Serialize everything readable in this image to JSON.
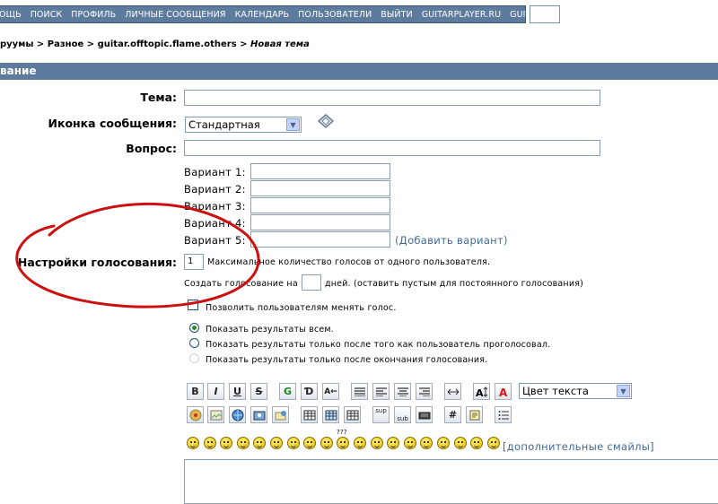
{
  "nav": {
    "items": [
      "ОЩЬ",
      "ПОИСК",
      "ПРОФИЛЬ",
      "ЛИЧНЫЕ СООБЩЕНИЯ",
      "КАЛЕНДАРЬ",
      "ПОЛЬЗОВАТЕЛИ",
      "ВЫЙТИ",
      "GUITARPLAYER.RU",
      "GUITARWIKI"
    ]
  },
  "breadcrumb": {
    "items": [
      "руумы",
      "Разное",
      "guitar.offtopic.flame.others"
    ],
    "separator": ">",
    "current": "Новая тема"
  },
  "section": {
    "title": "вание"
  },
  "form": {
    "subject_label": "Тема:",
    "icon_label": "Иконка сообщения:",
    "icon_value": "Стандартная",
    "question_label": "Вопрос:",
    "options": [
      {
        "label": "Вариант 1:"
      },
      {
        "label": "Вариант 2:"
      },
      {
        "label": "Вариант 3:"
      },
      {
        "label": "Вариант 4:"
      },
      {
        "label": "Вариант 5:"
      }
    ],
    "add_option": "(Добавить вариант)",
    "poll_settings_label": "Настройки голосования:",
    "max_votes_value": "1",
    "max_votes_text": "Максимальное количество голосов от одного пользователя.",
    "duration_before": "Создать голосование на",
    "duration_after": "дней. (оставить пустым для постоянного голосования)",
    "allow_change": "Позволить пользователям менять голос.",
    "result_options": [
      "Показать результаты всем.",
      "Показать результаты только после того как пользователь проголосовал.",
      "Показать результаты только после окончания голосования."
    ]
  },
  "toolbar": {
    "row1": [
      "B",
      "I",
      "U",
      "S",
      "G",
      "Ɗ",
      "A←"
    ],
    "color_select": "Цвет текста",
    "sup": "sup",
    "sub": "sub",
    "hash": "#"
  },
  "smilies": {
    "more_link": "[дополнительные смайлы]",
    "count": 19,
    "extra": "???"
  },
  "colors": {
    "nav_bg": "#5d7b9d",
    "link": "#3e6a9a",
    "annotation": "#cc1010"
  }
}
